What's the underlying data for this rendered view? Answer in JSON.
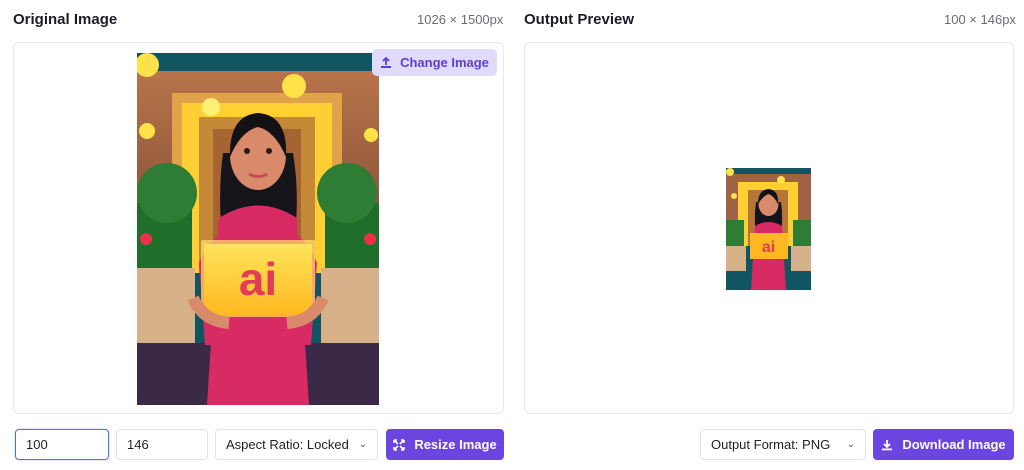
{
  "original": {
    "title": "Original Image",
    "dimensions": "1026 × 1500px",
    "change_label": "Change Image",
    "sign_text": "ai"
  },
  "preview": {
    "title": "Output Preview",
    "dimensions": "100 × 146px",
    "sign_text": "ai"
  },
  "controls": {
    "width_value": "100",
    "height_value": "146",
    "aspect_label": "Aspect Ratio: Locked",
    "resize_label": "Resize Image",
    "format_label": "Output Format: PNG",
    "download_label": "Download Image"
  },
  "colors": {
    "accent": "#6a45e0",
    "accent_light": "#e0dbfb",
    "focus": "#4a7bd0"
  },
  "icons": {
    "change": "upload-icon",
    "resize": "resize-arrows-icon",
    "download": "download-icon",
    "aspect_chevron": "chevron-down-icon",
    "format_chevron": "chevron-down-icon"
  }
}
